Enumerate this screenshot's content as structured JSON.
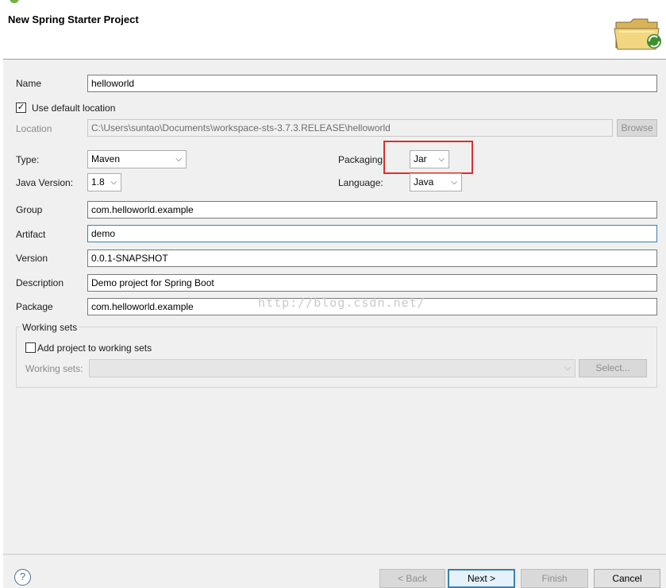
{
  "dialog": {
    "title": "New Spring Starter Project"
  },
  "form": {
    "name_label": "Name",
    "name_value": "helloworld",
    "use_default_location_label": "Use default location",
    "use_default_location_checked": "✓",
    "location_label": "Location",
    "location_value": "C:\\Users\\suntao\\Documents\\workspace-sts-3.7.3.RELEASE\\helloworld",
    "browse_label": "Browse",
    "type_label": "Type:",
    "type_value": "Maven",
    "packaging_label": "Packaging",
    "packaging_value": "Jar",
    "java_version_label": "Java Version:",
    "java_version_value": "1.8",
    "language_label": "Language:",
    "language_value": "Java",
    "group_label": "Group",
    "group_value": "com.helloworld.example",
    "artifact_label": "Artifact",
    "artifact_value": "demo",
    "version_label": "Version",
    "version_value": "0.0.1-SNAPSHOT",
    "description_label": "Description",
    "description_value": "Demo project for Spring Boot",
    "package_label": "Package",
    "package_value": "com.helloworld.example"
  },
  "working_sets": {
    "group_title": "Working sets",
    "add_label": "Add project to working sets",
    "sets_label": "Working sets:",
    "select_label": "Select..."
  },
  "watermark": "http://blog.csdn.net/",
  "footer": {
    "help_symbol": "?",
    "back_label": "< Back",
    "next_label": "Next >",
    "finish_label": "Finish",
    "cancel_label": "Cancel"
  },
  "icons": {
    "chevron": "⌵",
    "wizard": "spring-folder-icon"
  },
  "colors": {
    "highlight": "#d9302c",
    "focus": "#3c7fb1",
    "spring_green": "#6db33f"
  }
}
